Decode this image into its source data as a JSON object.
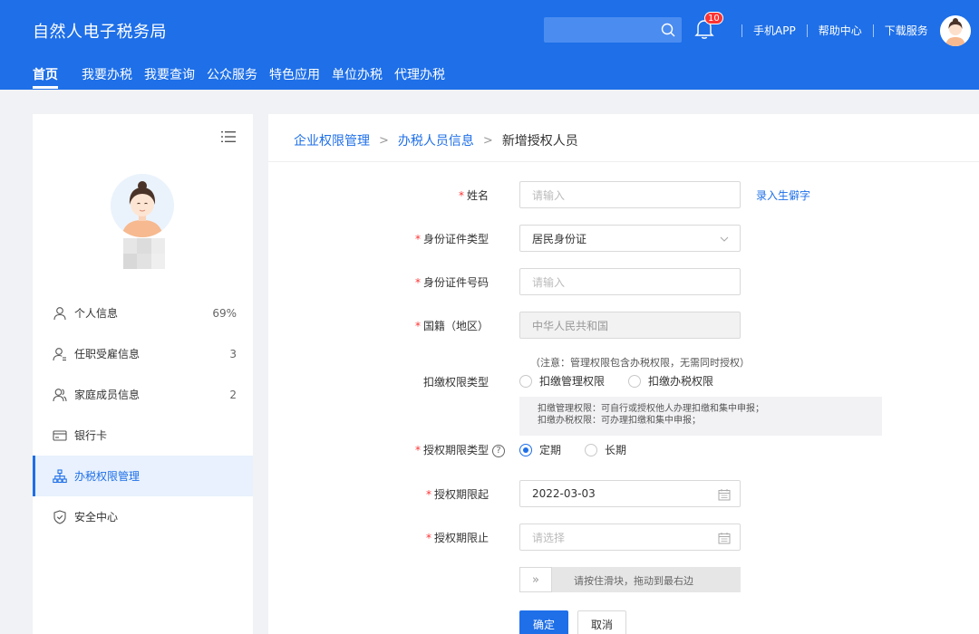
{
  "header": {
    "logo": "自然人电子税务局",
    "search_placeholder": "",
    "notification_count": "10",
    "links": [
      "手机APP",
      "帮助中心",
      "下载服务"
    ],
    "accent_color": "#1e6fe8"
  },
  "nav": {
    "items": [
      "首页",
      "我要办税",
      "我要查询",
      "公众服务",
      "特色应用",
      "单位办税",
      "代理办税"
    ],
    "active": "首页"
  },
  "sidebar": {
    "items": [
      {
        "label": "个人信息",
        "count": "69%",
        "icon": "person-icon"
      },
      {
        "label": "任职受雇信息",
        "count": "3",
        "icon": "employment-icon"
      },
      {
        "label": "家庭成员信息",
        "count": "2",
        "icon": "family-icon"
      },
      {
        "label": "银行卡",
        "count": "",
        "icon": "bank-card-icon"
      },
      {
        "label": "办税权限管理",
        "count": "",
        "icon": "org-chart-icon",
        "active": true
      },
      {
        "label": "安全中心",
        "count": "",
        "icon": "shield-icon"
      }
    ]
  },
  "breadcrumb": {
    "items": [
      "企业权限管理",
      "办税人员信息"
    ],
    "current": "新增授权人员",
    "separator": ">"
  },
  "form": {
    "name_label": "姓名",
    "name_placeholder": "请输入",
    "rare_char_link": "录入生僻字",
    "id_type_label": "身份证件类型",
    "id_type_value": "居民身份证",
    "id_number_label": "身份证件号码",
    "id_number_placeholder": "请输入",
    "nationality_label": "国籍（地区）",
    "nationality_value": "中华人民共和国",
    "deduction_note": "（注意：管理权限包含办税权限，无需同时授权）",
    "deduction_label": "扣缴权限类型",
    "deduction_options": [
      "扣缴管理权限",
      "扣缴办税权限"
    ],
    "deduction_info_line1": "扣缴管理权限：可自行或授权他人办理扣缴和集中申报；",
    "deduction_info_line2": "扣缴办税权限：可办理扣缴和集中申报；",
    "period_type_label": "授权期限类型",
    "period_type_help": "?",
    "period_options": [
      "定期",
      "长期"
    ],
    "period_selected": "定期",
    "start_label": "授权期限起",
    "start_value": "2022-03-03",
    "end_label": "授权期限止",
    "end_placeholder": "请选择",
    "slider_handle": "»",
    "slider_text": "请按住滑块，拖动到最右边",
    "confirm": "确定",
    "cancel": "取消"
  }
}
